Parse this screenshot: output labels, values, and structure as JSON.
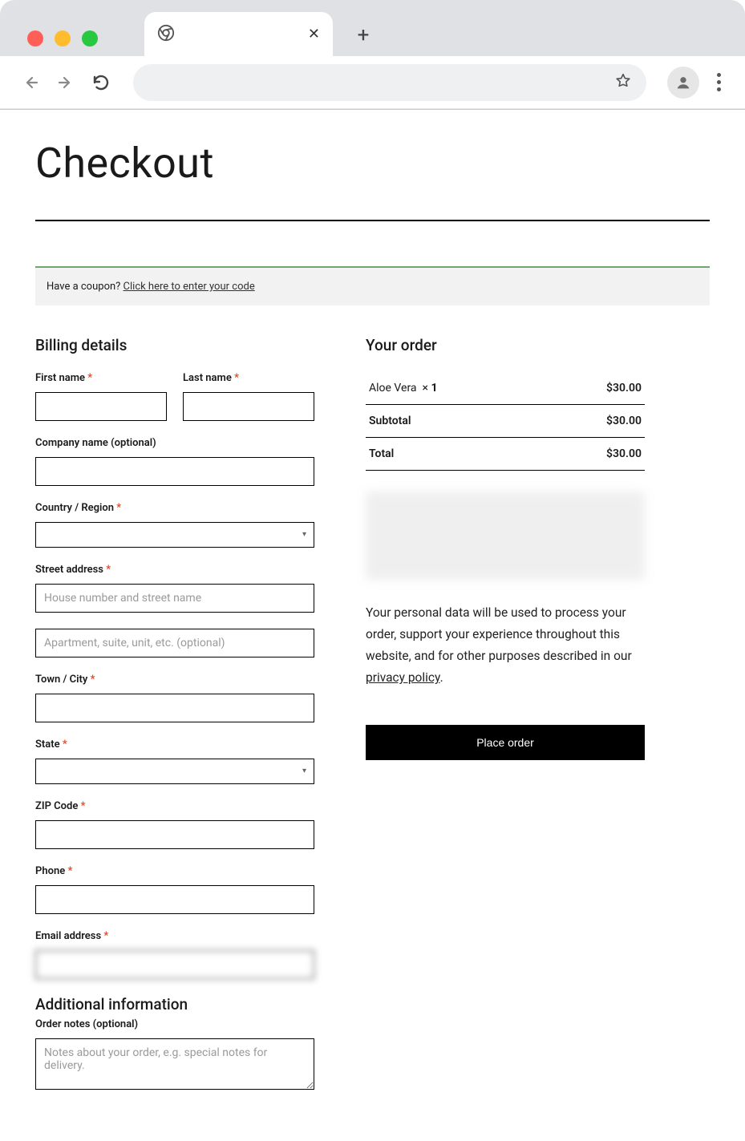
{
  "page": {
    "title": "Checkout"
  },
  "coupon": {
    "prompt": "Have a coupon? ",
    "link_text": "Click here to enter your code"
  },
  "billing": {
    "heading": "Billing details",
    "first_name_label": "First name",
    "last_name_label": "Last name",
    "company_label": "Company name (optional)",
    "country_label": "Country / Region",
    "country_value": "",
    "street_label": "Street address",
    "street_placeholder": "House number and street name",
    "street2_placeholder": "Apartment, suite, unit, etc. (optional)",
    "city_label": "Town / City",
    "state_label": "State",
    "state_value": "",
    "zip_label": "ZIP Code",
    "phone_label": "Phone",
    "email_label": "Email address",
    "email_value": ""
  },
  "additional": {
    "heading": "Additional information",
    "notes_label": "Order notes (optional)",
    "notes_placeholder": "Notes about your order, e.g. special notes for delivery."
  },
  "order": {
    "heading": "Your order",
    "item_name": "Aloe Vera",
    "item_qty_prefix": "×",
    "item_qty": "1",
    "item_total": "$30.00",
    "subtotal_label": "Subtotal",
    "subtotal": "$30.00",
    "total_label": "Total",
    "total": "$30.00",
    "privacy_text_1": "Your personal data will be used to process your order, support your experience throughout this website, and for other purposes described in our ",
    "privacy_link": "privacy policy",
    "privacy_text_2": ".",
    "place_order_label": "Place order"
  },
  "required_mark": "*"
}
